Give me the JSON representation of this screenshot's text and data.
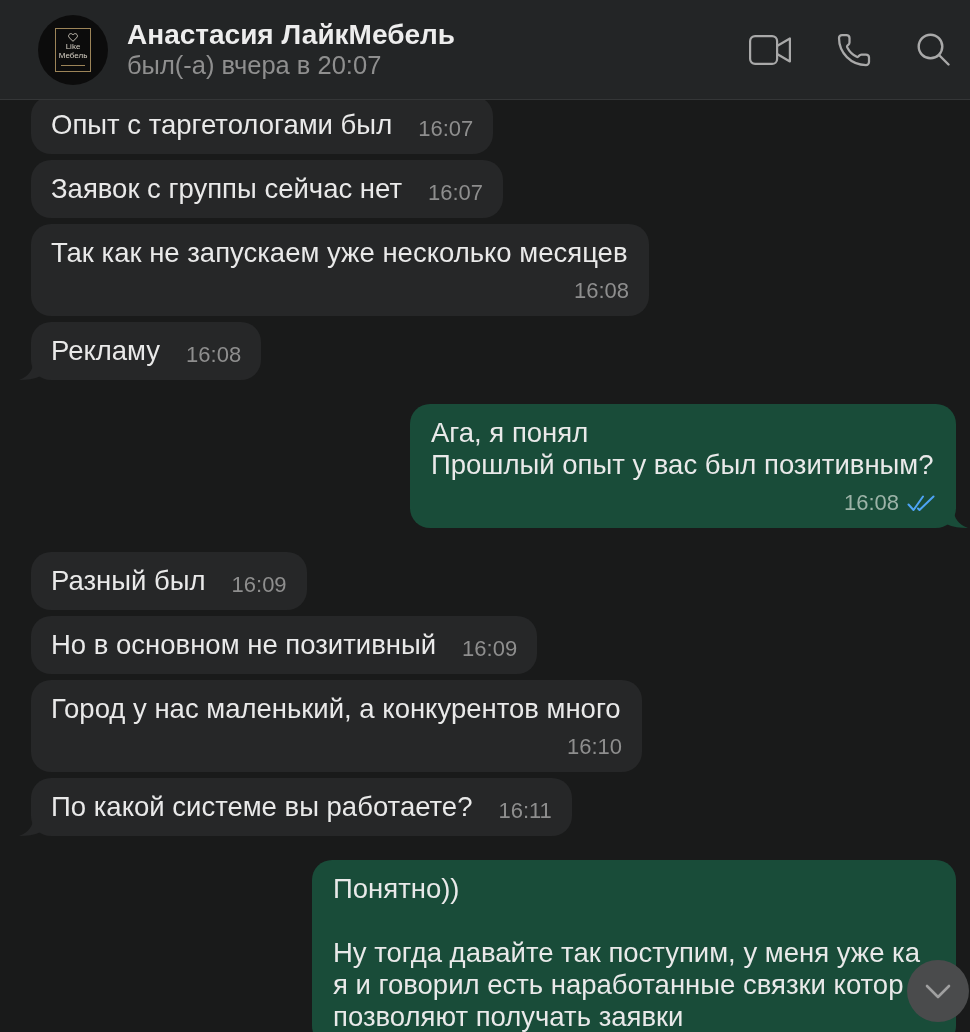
{
  "header": {
    "avatar": {
      "logo_lines": [
        "Like",
        "Мебель"
      ]
    },
    "name": "Анастасия ЛайкМебель",
    "status": "был(-а) вчера в 20:07"
  },
  "messages": [
    {
      "kind": "incoming",
      "text": "Опыт с таргетологами был",
      "time": "16:07"
    },
    {
      "kind": "incoming",
      "text": "Заявок с группы сейчас нет",
      "time": "16:07"
    },
    {
      "kind": "incoming",
      "text": "Так как не запускаем уже несколько месяцев",
      "time": "16:08"
    },
    {
      "kind": "incoming",
      "text": "Рекламу",
      "time": "16:08"
    },
    {
      "kind": "outgoing",
      "text": "Ага, я понял\nПрошлый опыт у вас был позитивным?",
      "time": "16:08",
      "read": true
    },
    {
      "kind": "incoming",
      "text": "Разный был",
      "time": "16:09"
    },
    {
      "kind": "incoming",
      "text": "Но в основном не позитивный",
      "time": "16:09"
    },
    {
      "kind": "incoming",
      "text": "Город у нас маленький, а конкурентов много",
      "time": "16:10"
    },
    {
      "kind": "incoming",
      "text": "По какой системе вы работаете?",
      "time": "16:11"
    },
    {
      "kind": "outgoing",
      "text": "Понятно))\n\nНу тогда давайте так поступим, у меня уже ка я и говорил есть наработанные связки котор позволяют получать заявки"
    }
  ]
}
